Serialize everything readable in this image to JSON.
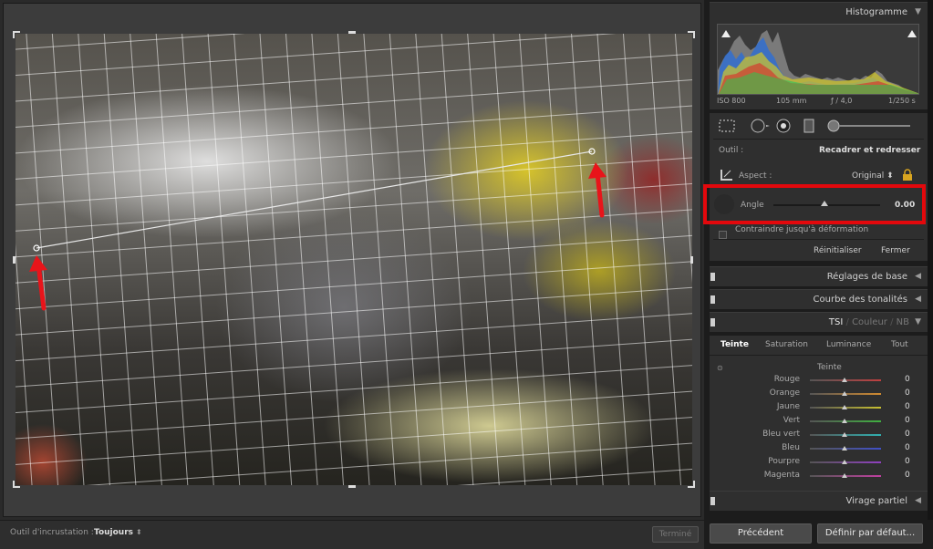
{
  "toolbar": {
    "overlay_label": "Outil d'incrustation :",
    "overlay_value": "Toujours",
    "done_label": "Terminé"
  },
  "histogram": {
    "title": "Histogramme",
    "iso": "ISO 800",
    "focal": "105 mm",
    "aperture": "ƒ / 4,0",
    "shutter": "1/250 s"
  },
  "crop": {
    "tool_label": "Outil :",
    "tool_value": "Recadrer et redresser",
    "aspect_label": "Aspect :",
    "aspect_value": "Original",
    "angle_label": "Angle",
    "angle_value": "0.00",
    "constrain_label": "Contraindre jusqu'à déformation",
    "reset_label": "Réinitialiser",
    "close_label": "Fermer"
  },
  "panels": {
    "basic": "Réglages de base",
    "tone_curve": "Courbe des tonalités",
    "hsl": "TSI",
    "color": "Couleur",
    "nb": "NB",
    "split": "Virage partiel"
  },
  "hsl_tabs": [
    "Teinte",
    "Saturation",
    "Luminance",
    "Tout"
  ],
  "hsl_section": "Teinte",
  "hsl_rows": [
    {
      "name": "Rouge",
      "value": "0",
      "color": "#c04040"
    },
    {
      "name": "Orange",
      "value": "0",
      "color": "#d08a30"
    },
    {
      "name": "Jaune",
      "value": "0",
      "color": "#c8c030"
    },
    {
      "name": "Vert",
      "value": "0",
      "color": "#40b040"
    },
    {
      "name": "Bleu vert",
      "value": "0",
      "color": "#30b0b0"
    },
    {
      "name": "Bleu",
      "value": "0",
      "color": "#4050c8"
    },
    {
      "name": "Pourpre",
      "value": "0",
      "color": "#9040c0"
    },
    {
      "name": "Magenta",
      "value": "0",
      "color": "#c040a0"
    }
  ],
  "buttons": {
    "previous": "Précédent",
    "defaults": "Définir par défaut..."
  },
  "accent": "#e3080c"
}
